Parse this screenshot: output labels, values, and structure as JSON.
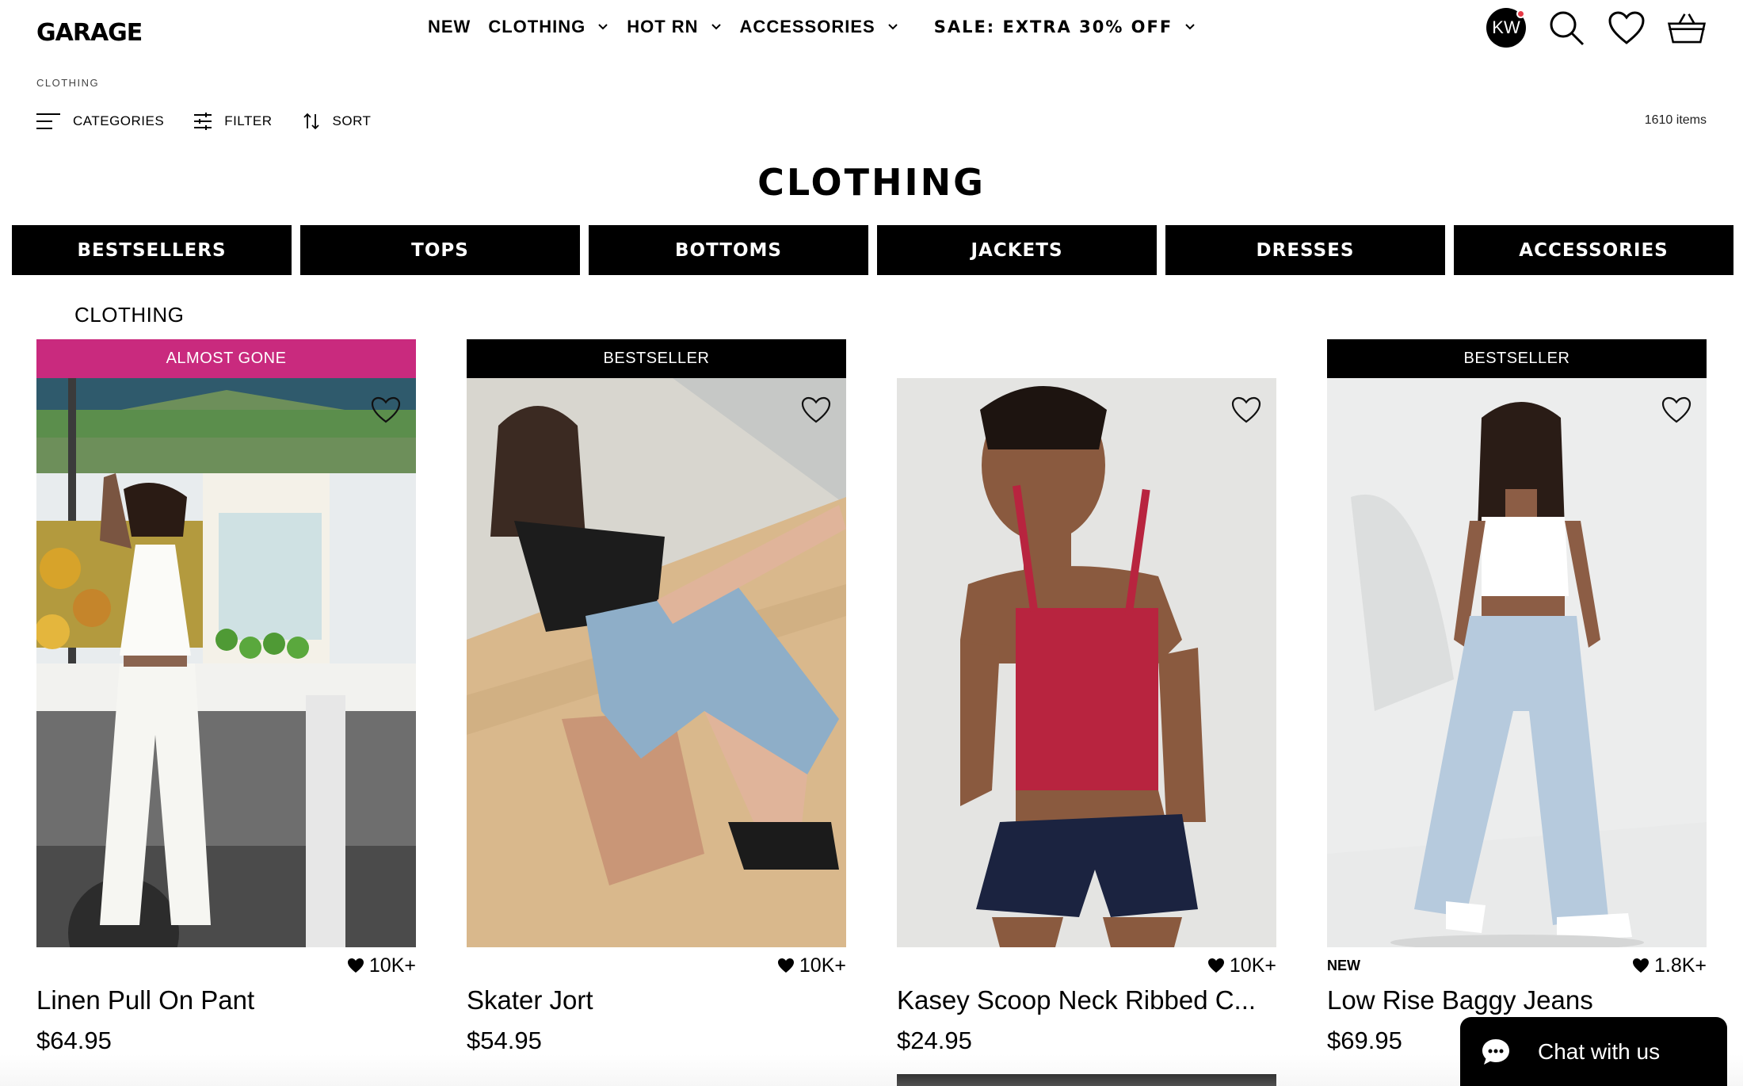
{
  "header": {
    "logo": "GARAGE",
    "nav": [
      {
        "label": "NEW"
      },
      {
        "label": "CLOTHING"
      },
      {
        "label": "HOT RN"
      },
      {
        "label": "ACCESSORIES"
      },
      {
        "label": "SALE: EXTRA 30% OFF"
      }
    ],
    "avatar_initials": "KW"
  },
  "breadcrumb": "CLOTHING",
  "toolbar": {
    "categories": "CATEGORIES",
    "filter": "FILTER",
    "sort": "SORT",
    "item_count": "1610 items"
  },
  "page_title": "CLOTHING",
  "category_tabs": [
    "BESTSELLERS",
    "TOPS",
    "BOTTOMS",
    "JACKETS",
    "DRESSES",
    "ACCESSORIES"
  ],
  "section_label": "CLOTHING",
  "products": [
    {
      "badge": "ALMOST GONE",
      "badge_color": "#c92a7e",
      "tag": "",
      "likes": "10K+",
      "name": "Linen Pull On Pant",
      "price": "$64.95"
    },
    {
      "badge": "BESTSELLER",
      "badge_color": "#000000",
      "tag": "",
      "likes": "10K+",
      "name": "Skater Jort",
      "price": "$54.95"
    },
    {
      "badge": "",
      "badge_color": "",
      "tag": "",
      "likes": "10K+",
      "name": "Kasey Scoop Neck Ribbed C...",
      "price": "$24.95"
    },
    {
      "badge": "BESTSELLER",
      "badge_color": "#000000",
      "tag": "NEW",
      "likes": "1.8K+",
      "name": "Low Rise Baggy Jeans",
      "price": "$69.95"
    }
  ],
  "chat": {
    "label": "Chat with us"
  },
  "colors": {
    "sale_badge": "#c92a7e",
    "black": "#000000",
    "notification": "#e63a46"
  }
}
